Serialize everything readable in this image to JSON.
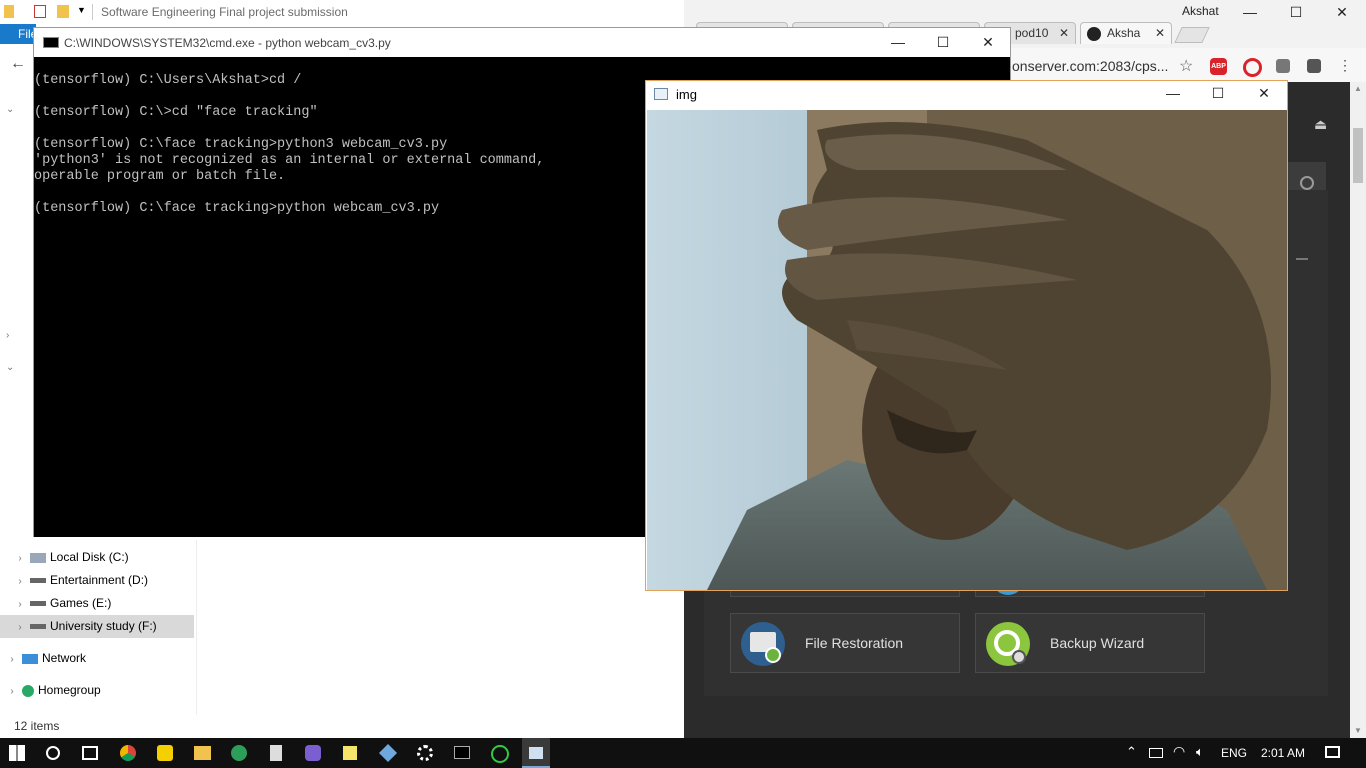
{
  "explorer": {
    "title": "Software Engineering Final project submission",
    "file_tab": "File",
    "tree": [
      {
        "label": "Local Disk (C:)",
        "icon": "local-disk-icon"
      },
      {
        "label": "Entertainment (D:)",
        "icon": "drive-icon"
      },
      {
        "label": "Games (E:)",
        "icon": "drive-icon"
      },
      {
        "label": "University study (F:)",
        "icon": "drive-icon",
        "selected": true
      },
      {
        "label": "Network",
        "icon": "network-icon"
      },
      {
        "label": "Homegroup",
        "icon": "homegroup-icon"
      }
    ],
    "status": "12 items"
  },
  "cmd": {
    "title": "C:\\WINDOWS\\SYSTEM32\\cmd.exe - python  webcam_cv3.py",
    "output": "(tensorflow) C:\\Users\\Akshat>cd /\n\n(tensorflow) C:\\>cd \"face tracking\"\n\n(tensorflow) C:\\face tracking>python3 webcam_cv3.py\n'python3' is not recognized as an internal or external command,\noperable program or batch file.\n\n(tensorflow) C:\\face tracking>python webcam_cv3.py"
  },
  "img_window": {
    "title": "img"
  },
  "chrome": {
    "user": "Akshat",
    "tabs": [
      {
        "label": ""
      },
      {
        "label": ""
      },
      {
        "label": ""
      },
      {
        "label": "pod10",
        "close": "✕"
      },
      {
        "label": "Aksha",
        "close": "✕"
      }
    ],
    "url": "onserver.com:2083/cps...",
    "extension_abp": "ABP",
    "more": "»",
    "tiles": [
      {
        "label": "File Restoration",
        "icon": "file-restoration-icon"
      },
      {
        "label": "Backup Wizard",
        "icon": "backup-wizard-icon"
      }
    ]
  },
  "taskbar": {
    "language": "ENG",
    "time": "2:01 AM"
  },
  "colors": {
    "explorer_ribbon": "#1979ca",
    "chrome_page": "#2b2b2b",
    "taskbar": "#101010",
    "img_border": "#e2a25c"
  }
}
